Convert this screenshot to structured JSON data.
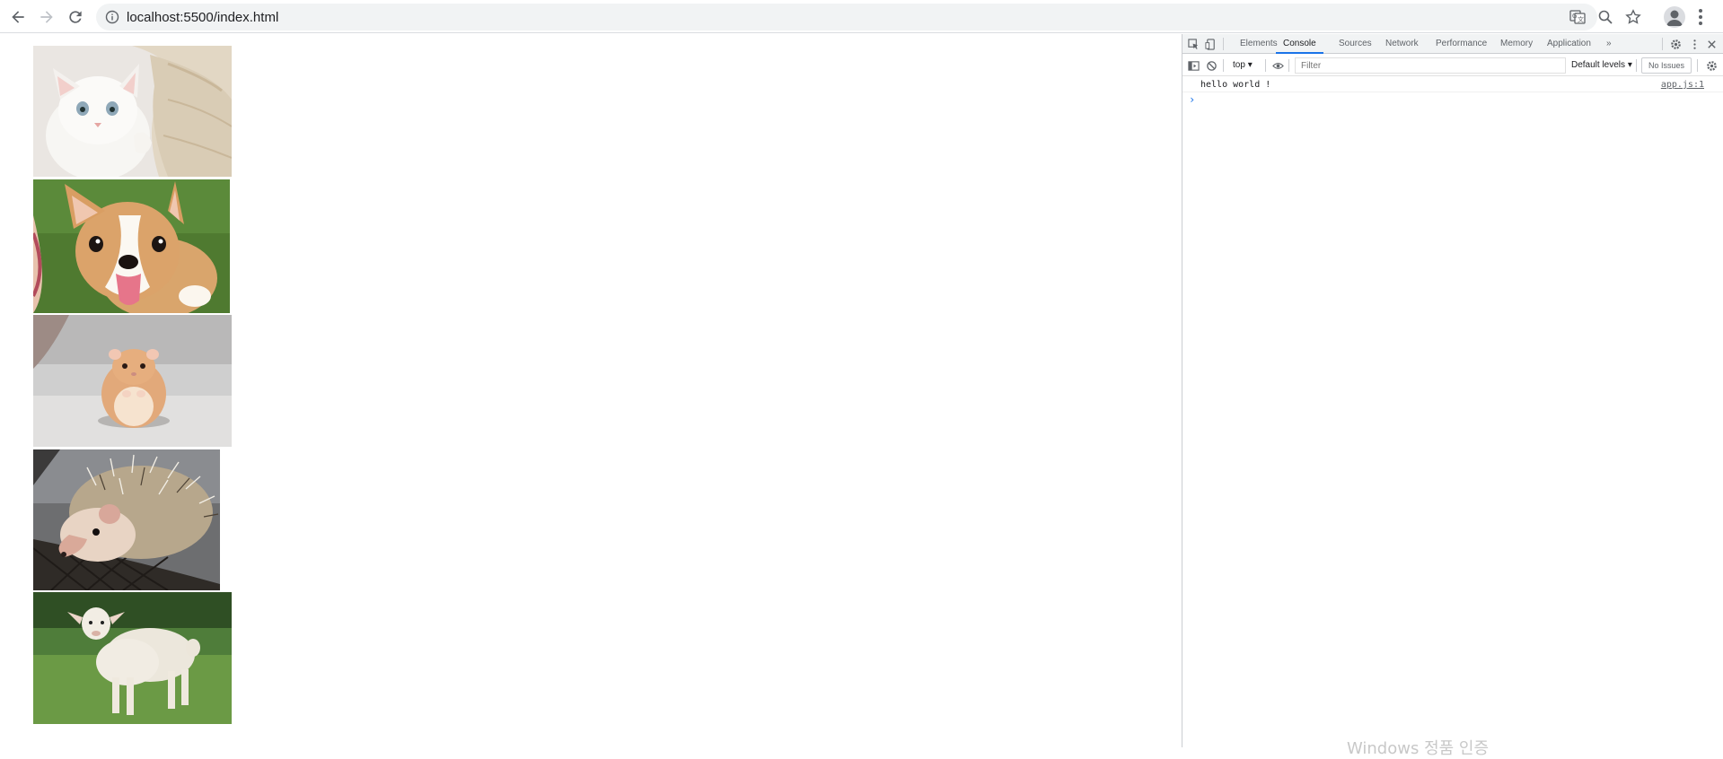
{
  "browser": {
    "url": "localhost:5500/index.html",
    "buttons": {
      "back": "back-arrow-icon",
      "forward": "forward-arrow-icon",
      "reload": "reload-icon"
    }
  },
  "page": {
    "images": [
      {
        "name": "kitten-image",
        "subject": "white kitten"
      },
      {
        "name": "corgi-image",
        "subject": "corgi puppy"
      },
      {
        "name": "hamster-image",
        "subject": "hamster"
      },
      {
        "name": "hedgehog-image",
        "subject": "hedgehog"
      },
      {
        "name": "lamb-image",
        "subject": "lamb"
      }
    ]
  },
  "devtools": {
    "tabs": [
      "Elements",
      "Console",
      "Sources",
      "Network",
      "Performance",
      "Memory",
      "Application"
    ],
    "more_tabs": "»",
    "active_tab": "Console",
    "context": "top",
    "filter_placeholder": "Filter",
    "levels": "Default levels",
    "issues": "No Issues",
    "console": [
      {
        "message": "hello world !",
        "source": "app.js:1"
      }
    ],
    "prompt": "›"
  },
  "watermark": "Windows 정품 인증",
  "colors": {
    "accent": "#1a73e8",
    "toolbar": "#f1f3f4",
    "border": "#cbcdd1"
  }
}
